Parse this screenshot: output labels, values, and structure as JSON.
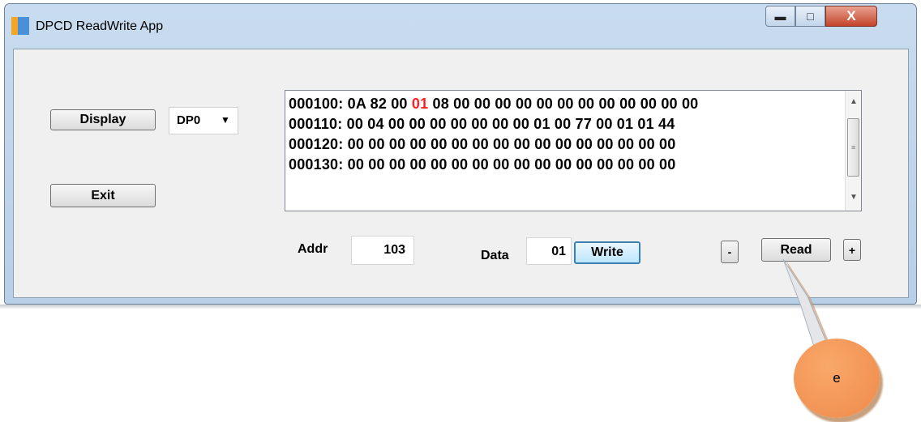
{
  "window": {
    "title": "DPCD ReadWrite App"
  },
  "controls": {
    "min_icon": "minimize-icon",
    "max_icon": "maximize-icon",
    "close_glyph": "X"
  },
  "left": {
    "display_label": "Display",
    "port_value": "DP0",
    "exit_label": "Exit"
  },
  "dump": {
    "lines": [
      {
        "pre": "000100: 0A 82 00 ",
        "hl": "01",
        "post": " 08 00 00 00 00 00 00 00 00 00 00 00 00"
      },
      {
        "pre": "000110: 00 04 00 00 00 00 00 00 00 01 00 77 00 01 01 44",
        "hl": "",
        "post": ""
      },
      {
        "pre": "000120: 00 00 00 00 00 00 00 00 00 00 00 00 00 00 00 00",
        "hl": "",
        "post": ""
      },
      {
        "pre": "000130: 00 00 00 00 00 00 00 00 00 00 00 00 00 00 00 00",
        "hl": "",
        "post": ""
      }
    ],
    "highlight_color": "#ff2020"
  },
  "bottom": {
    "addr_label": "Addr",
    "addr_value": "103",
    "data_label": "Data",
    "data_value": "01",
    "write_label": "Write",
    "minus_label": "-",
    "read_label": "Read",
    "plus_label": "+"
  },
  "callout": {
    "label": "e",
    "color": "#ee8a4a"
  }
}
